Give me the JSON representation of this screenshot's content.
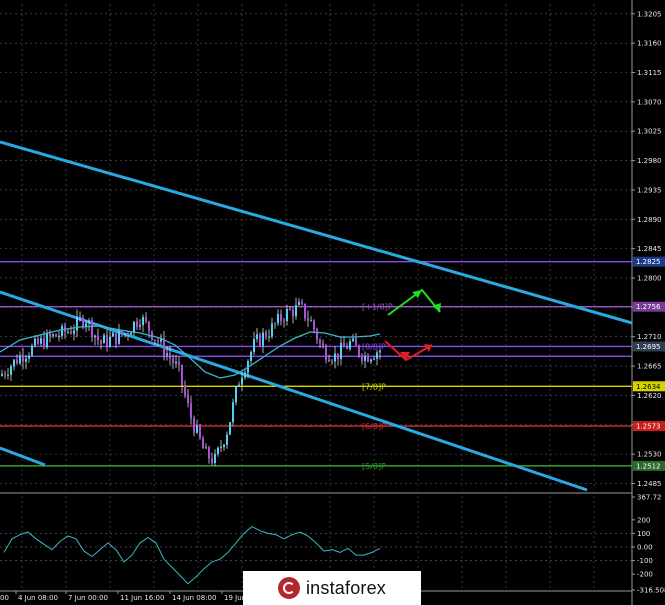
{
  "chart_data": {
    "type": "candlestick",
    "price_axis": {
      "ticks": [
        "1.3205",
        "1.3160",
        "1.3115",
        "1.3070",
        "1.3025",
        "1.2980",
        "1.2935",
        "1.2890",
        "1.2845",
        "1.2800",
        "1.2755",
        "1.2710",
        "1.2665",
        "1.2620",
        "1.2575",
        "1.2530",
        "1.2485"
      ],
      "ylim": [
        1.2475,
        1.322
      ]
    },
    "price_tags": [
      {
        "value": "1.2825",
        "price": 1.2825,
        "color": "#1a3a8a"
      },
      {
        "value": "1.2756",
        "price": 1.2756,
        "color": "#7a3a9a"
      },
      {
        "value": "1.2695",
        "price": 1.2695,
        "color": "#2f3f52"
      },
      {
        "value": "1.2634",
        "price": 1.2634,
        "color": "#d4d400",
        "text": "#000000"
      },
      {
        "value": "1.2573",
        "price": 1.2573,
        "color": "#c81e1e"
      },
      {
        "value": "1.2512",
        "price": 1.2512,
        "color": "#2a6a2a"
      }
    ],
    "murrey_lines": [
      {
        "label": "",
        "price": 1.2825,
        "color": "#8a4af0"
      },
      {
        "label": "[+1/8]P",
        "price": 1.2756,
        "color": "#a050d0"
      },
      {
        "label": "[8/8]P",
        "price": 1.2695,
        "color": "#8a4af0"
      },
      {
        "label": "",
        "price": 1.268,
        "color": "#8a4af0"
      },
      {
        "label": "[7/8]P",
        "price": 1.2634,
        "color": "#d4d400"
      },
      {
        "label": "[6/8]P",
        "price": 1.2573,
        "color": "#d03030"
      },
      {
        "label": "[5/8]P",
        "price": 1.2512,
        "color": "#30a030"
      }
    ],
    "time_labels": [
      "4 Jun 08:00",
      "7 Jun 00:00",
      "11 Jun 16:00",
      "14 Jun 08:00",
      "19 Jun"
    ],
    "time_label_partial": "00",
    "oscillator": {
      "ticks": [
        "367.72",
        "200",
        "100",
        "0.00",
        "-100",
        "-200",
        "-316.508"
      ],
      "ylim": [
        -316.508,
        367.72
      ],
      "values": [
        -40,
        60,
        90,
        110,
        60,
        20,
        -20,
        40,
        80,
        60,
        -30,
        -70,
        -20,
        30,
        -20,
        -110,
        -60,
        30,
        70,
        30,
        -90,
        -150,
        -210,
        -270,
        -220,
        -160,
        -110,
        -90,
        -40,
        30,
        100,
        150,
        120,
        100,
        90,
        60,
        90,
        110,
        80,
        30,
        -30,
        -20,
        -40,
        -10,
        -60,
        -60,
        -40,
        -10
      ]
    }
  },
  "watermark": {
    "text": "instaforex"
  }
}
